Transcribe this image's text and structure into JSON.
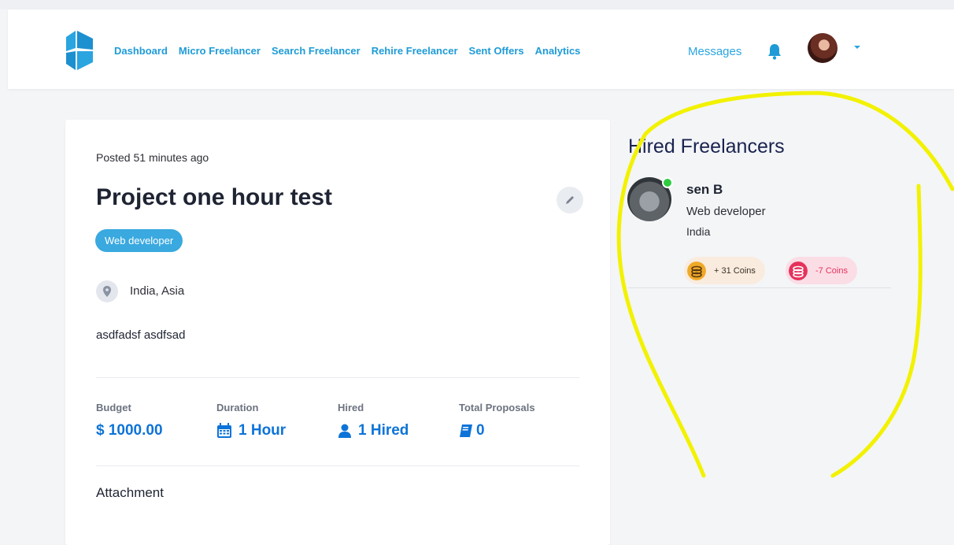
{
  "header": {
    "nav": [
      {
        "label": "Dashboard"
      },
      {
        "label": "Micro Freelancer"
      },
      {
        "label": "Search Freelancer"
      },
      {
        "label": "Rehire Freelancer"
      },
      {
        "label": "Sent Offers"
      },
      {
        "label": "Analytics"
      }
    ],
    "messages_label": "Messages"
  },
  "project": {
    "posted": "Posted 51 minutes ago",
    "title": "Project one hour test",
    "tag": "Web developer",
    "location": "India, Asia",
    "description": "asdfadsf asdfsad",
    "stats": [
      {
        "label": "Budget",
        "value": "$ 1000.00",
        "icon": "dollar-icon"
      },
      {
        "label": "Duration",
        "value": "1 Hour",
        "icon": "calendar-icon"
      },
      {
        "label": "Hired",
        "value": "1 Hired",
        "icon": "user-icon"
      },
      {
        "label": "Total Proposals",
        "value": "0",
        "icon": "book-icon"
      }
    ],
    "attachment_label": "Attachment"
  },
  "sidebar": {
    "title": "Hired Freelancers",
    "freelancer": {
      "name": "sen B",
      "role": "Web developer",
      "country": "India",
      "coins_positive": "+ 31 Coins",
      "coins_negative": "-7 Coins"
    }
  },
  "colors": {
    "accent": "#1e9bd7",
    "stat_blue": "#0d73d8",
    "tag_bg": "#3aa9df",
    "annotation": "#f2f200",
    "negative": "#e6325b"
  }
}
